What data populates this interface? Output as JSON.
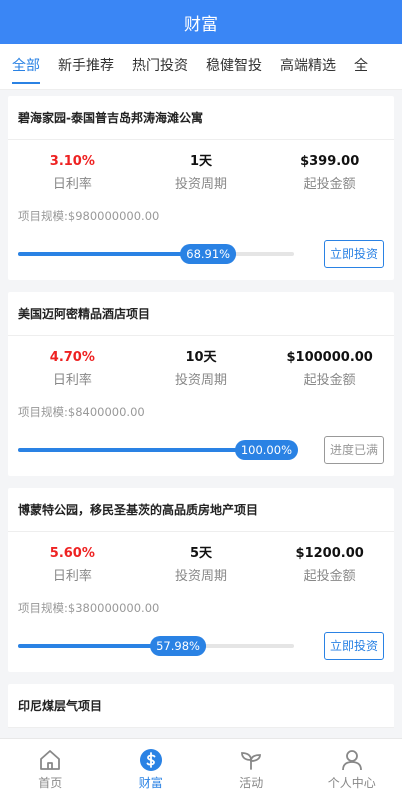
{
  "header": {
    "title": "财富"
  },
  "tabs": [
    "全部",
    "新手推荐",
    "热门投资",
    "稳健智投",
    "高端精选",
    "全"
  ],
  "products": [
    {
      "title": "碧海家园-泰国普吉岛邦涛海滩公寓",
      "rate": "3.10%",
      "rate_label": "日利率",
      "period": "1天",
      "period_label": "投资周期",
      "min": "$399.00",
      "min_label": "起投金额",
      "scale": "项目规模:$980000000.00",
      "progress": 0.6891,
      "progress_text": "68.91%",
      "button": "立即投资",
      "done": false
    },
    {
      "title": "美国迈阿密精品酒店项目",
      "rate": "4.70%",
      "rate_label": "日利率",
      "period": "10天",
      "period_label": "投资周期",
      "min": "$100000.00",
      "min_label": "起投金额",
      "scale": "项目规模:$8400000.00",
      "progress": 1.0,
      "progress_text": "100.00%",
      "button": "进度已满",
      "done": true
    },
    {
      "title": "博蒙特公园，移民圣基茨的高品质房地产项目",
      "rate": "5.60%",
      "rate_label": "日利率",
      "period": "5天",
      "period_label": "投资周期",
      "min": "$1200.00",
      "min_label": "起投金额",
      "scale": "项目规模:$380000000.00",
      "progress": 0.5798,
      "progress_text": "57.98%",
      "button": "立即投资",
      "done": false
    },
    {
      "title": "印尼煤层气项目"
    }
  ],
  "tabbar": [
    {
      "label": "首页",
      "icon": "home-icon"
    },
    {
      "label": "财富",
      "icon": "wealth-icon"
    },
    {
      "label": "活动",
      "icon": "sprout-icon"
    },
    {
      "label": "个人中心",
      "icon": "user-icon"
    }
  ],
  "colors": {
    "brand": "#3a86f5",
    "accent": "#2a82e4",
    "rate": "#e22222"
  }
}
